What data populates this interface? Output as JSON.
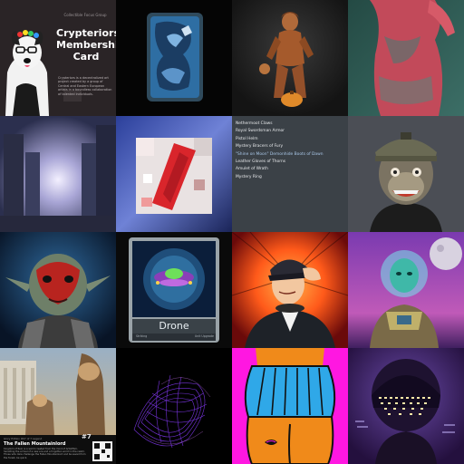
{
  "tiles": {
    "t1": {
      "group": "Collectible Focus Group",
      "title": [
        "Crypteriors",
        "Membership",
        "Card"
      ],
      "body": "Crypteriors is a decentralized art project created by a group of Central and Eastern European artists in a boundless collaboration of talented individuals."
    },
    "t7": {
      "items": [
        "Nethermoot Claws",
        "Royal Swordsman Armor",
        "Pistol Helm",
        "Mystery Bracers of Fury",
        "\"Shine on Moon\" Demonhide Boots of Dawn",
        "Leather Gloves of Thorns",
        "Amulet of Wrath",
        "Mystery Ring"
      ]
    },
    "t10": {
      "name": "Drone",
      "stat_left": "Striking",
      "stat_right": "Unit Upgrade"
    },
    "t13": {
      "header": "Glory Edition #07 of 7 Legend",
      "number": "#7",
      "title": "The Fallen Mountainlord",
      "body": "Kingdom of Ruin is a world created from the mind of ArtistTom, heralding the arrival of a new era and a forgotten world in the realm. Those who dare challenge the Fallen Mountainlord and be saved from the forest, be quick."
    }
  },
  "colors": {
    "t1_bg": "#2a2426",
    "t2_bg": "#050505",
    "t3_bg": "#1a1a1a",
    "t4_bg": "#2c5e56",
    "t8_bg": "#4b4e55",
    "t9_bg": "#0c1b36",
    "t11_accent": "#ff6a1a",
    "t15_bg": "#ff17e1",
    "t15_skirt": "#2fa8e8",
    "t16_bg": "#3a1f6b"
  }
}
